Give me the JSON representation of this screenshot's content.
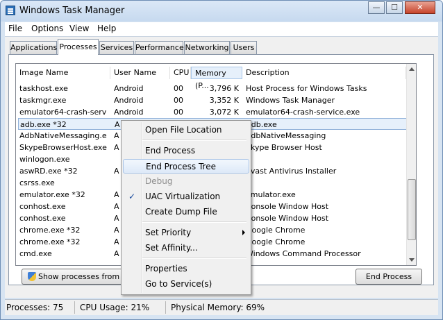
{
  "window": {
    "title": "Windows Task Manager",
    "min": "—",
    "max": "☐",
    "close": "✕"
  },
  "menubar": [
    "File",
    "Options",
    "View",
    "Help"
  ],
  "tabs": [
    "Applications",
    "Processes",
    "Services",
    "Performance",
    "Networking",
    "Users"
  ],
  "active_tab": "Processes",
  "columns": {
    "name": "Image Name",
    "user": "User Name",
    "cpu": "CPU",
    "mem": "Memory (P...",
    "desc": "Description"
  },
  "rows": [
    {
      "name": "taskhost.exe",
      "user": "Android",
      "cpu": "00",
      "mem": "3,796 K",
      "desc": "Host Process for Windows Tasks"
    },
    {
      "name": "taskmgr.exe",
      "user": "Android",
      "cpu": "00",
      "mem": "3,352 K",
      "desc": "Windows Task Manager"
    },
    {
      "name": "emulator64-crash-servi...",
      "user": "Android",
      "cpu": "00",
      "mem": "3,072 K",
      "desc": "emulator64-crash-service.exe"
    },
    {
      "name": "adb.exe *32",
      "user": "A",
      "cpu": "",
      "mem": "",
      "desc": "adb.exe"
    },
    {
      "name": "AdbNativeMessaging.exe",
      "user": "A",
      "cpu": "",
      "mem": "",
      "desc": "AdbNativeMessaging"
    },
    {
      "name": "SkypeBrowserHost.exe...",
      "user": "A",
      "cpu": "",
      "mem": "",
      "desc": "Skype Browser Host"
    },
    {
      "name": "winlogon.exe",
      "user": "",
      "cpu": "",
      "mem": "",
      "desc": ""
    },
    {
      "name": "aswRD.exe *32",
      "user": "A",
      "cpu": "",
      "mem": "",
      "desc": "Avast Antivirus Installer"
    },
    {
      "name": "csrss.exe",
      "user": "",
      "cpu": "",
      "mem": "",
      "desc": ""
    },
    {
      "name": "emulator.exe *32",
      "user": "A",
      "cpu": "",
      "mem": "",
      "desc": "emulator.exe"
    },
    {
      "name": "conhost.exe",
      "user": "A",
      "cpu": "",
      "mem": "",
      "desc": "Console Window Host"
    },
    {
      "name": "conhost.exe",
      "user": "A",
      "cpu": "",
      "mem": "",
      "desc": "Console Window Host"
    },
    {
      "name": "chrome.exe *32",
      "user": "A",
      "cpu": "",
      "mem": "",
      "desc": "Google Chrome"
    },
    {
      "name": "chrome.exe *32",
      "user": "A",
      "cpu": "",
      "mem": "",
      "desc": "Google Chrome"
    },
    {
      "name": "cmd.exe",
      "user": "A",
      "cpu": "",
      "mem": "",
      "desc": "Windows Command Processor"
    }
  ],
  "buttons": {
    "show_all": "Show processes from all u",
    "end_process": "End Process"
  },
  "status": {
    "processes": "Processes: 75",
    "cpu": "CPU Usage: 21%",
    "memory": "Physical Memory: 69%"
  },
  "context_menu": {
    "items": [
      {
        "label": "Open File Location"
      },
      {
        "label": "End Process"
      },
      {
        "label": "End Process Tree",
        "highlighted": true
      },
      {
        "label": "Debug",
        "disabled": true
      },
      {
        "label": "UAC Virtualization",
        "checked": true,
        "check": "✓"
      },
      {
        "label": "Create Dump File"
      },
      {
        "label": "Set Priority",
        "submenu": true
      },
      {
        "label": "Set Affinity..."
      },
      {
        "label": "Properties"
      },
      {
        "label": "Go to Service(s)"
      }
    ]
  }
}
